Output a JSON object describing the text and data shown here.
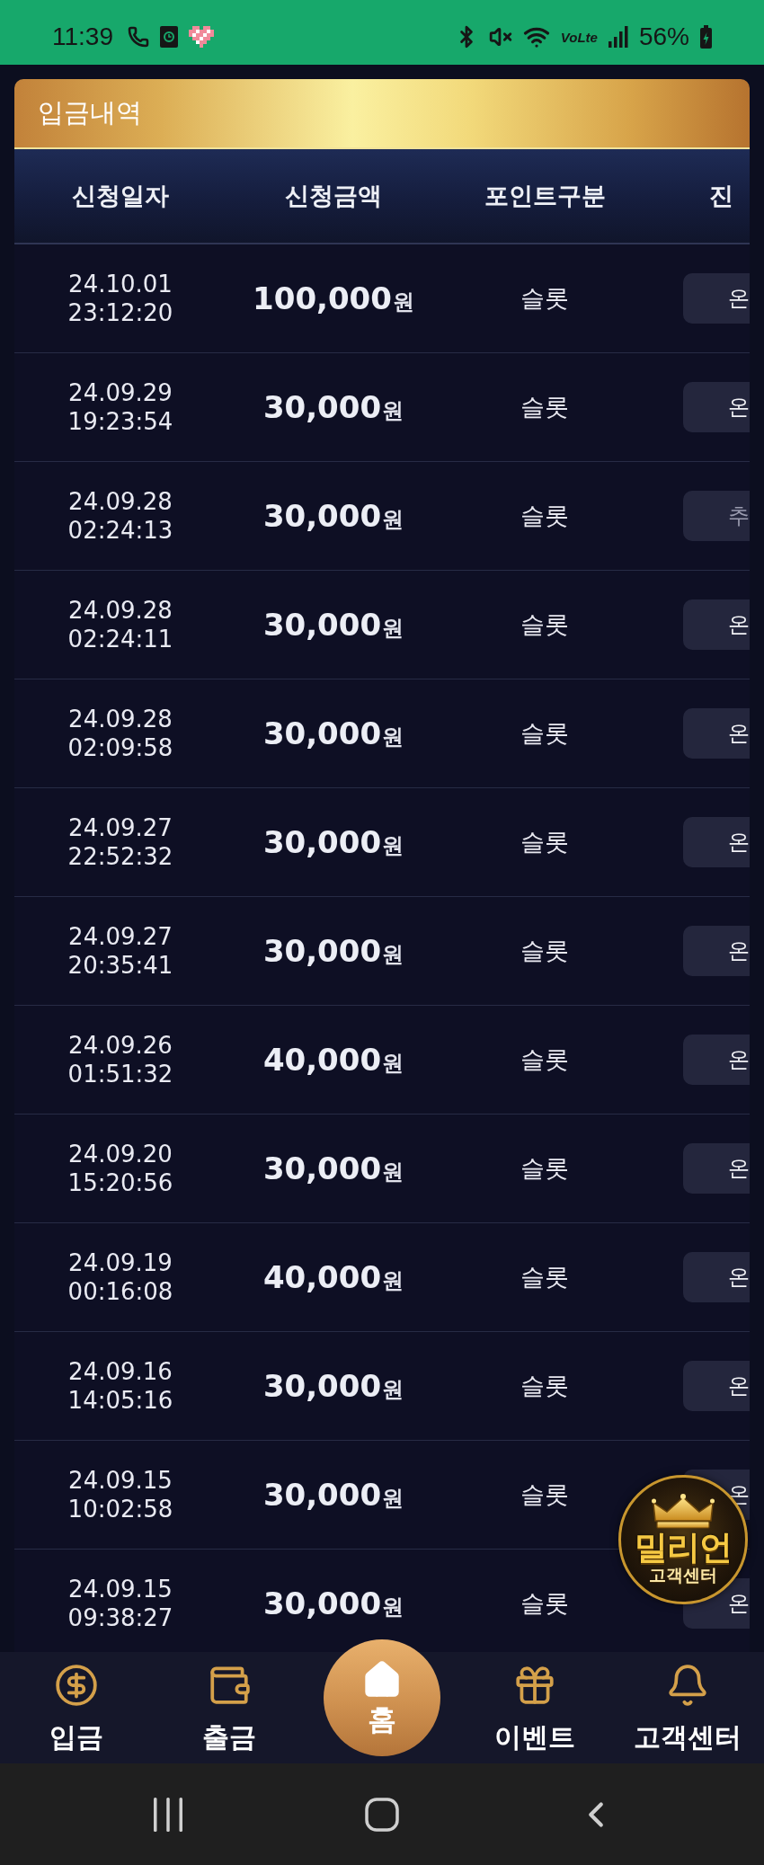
{
  "status_bar": {
    "time": "11:39",
    "network_label": "VoLte",
    "battery": "56%"
  },
  "panel": {
    "title": "입금내역"
  },
  "table": {
    "columns": [
      "신청일자",
      "신청금액",
      "포인트구분",
      "진"
    ],
    "rows": [
      {
        "date": "24.10.01",
        "time": "23:12:20",
        "amount": "100,000",
        "unit": "원",
        "point_type": "슬롯",
        "status": "온",
        "dimmed": false
      },
      {
        "date": "24.09.29",
        "time": "19:23:54",
        "amount": "30,000",
        "unit": "원",
        "point_type": "슬롯",
        "status": "온",
        "dimmed": false
      },
      {
        "date": "24.09.28",
        "time": "02:24:13",
        "amount": "30,000",
        "unit": "원",
        "point_type": "슬롯",
        "status": "추",
        "dimmed": true
      },
      {
        "date": "24.09.28",
        "time": "02:24:11",
        "amount": "30,000",
        "unit": "원",
        "point_type": "슬롯",
        "status": "온",
        "dimmed": false
      },
      {
        "date": "24.09.28",
        "time": "02:09:58",
        "amount": "30,000",
        "unit": "원",
        "point_type": "슬롯",
        "status": "온",
        "dimmed": false
      },
      {
        "date": "24.09.27",
        "time": "22:52:32",
        "amount": "30,000",
        "unit": "원",
        "point_type": "슬롯",
        "status": "온",
        "dimmed": false
      },
      {
        "date": "24.09.27",
        "time": "20:35:41",
        "amount": "30,000",
        "unit": "원",
        "point_type": "슬롯",
        "status": "온",
        "dimmed": false
      },
      {
        "date": "24.09.26",
        "time": "01:51:32",
        "amount": "40,000",
        "unit": "원",
        "point_type": "슬롯",
        "status": "온",
        "dimmed": false
      },
      {
        "date": "24.09.20",
        "time": "15:20:56",
        "amount": "30,000",
        "unit": "원",
        "point_type": "슬롯",
        "status": "온",
        "dimmed": false
      },
      {
        "date": "24.09.19",
        "time": "00:16:08",
        "amount": "40,000",
        "unit": "원",
        "point_type": "슬롯",
        "status": "온",
        "dimmed": false
      },
      {
        "date": "24.09.16",
        "time": "14:05:16",
        "amount": "30,000",
        "unit": "원",
        "point_type": "슬롯",
        "status": "온",
        "dimmed": false
      },
      {
        "date": "24.09.15",
        "time": "10:02:58",
        "amount": "30,000",
        "unit": "원",
        "point_type": "슬롯",
        "status": "온",
        "dimmed": false
      },
      {
        "date": "24.09.15",
        "time": "09:38:27",
        "amount": "30,000",
        "unit": "원",
        "point_type": "슬롯",
        "status": "온",
        "dimmed": false
      }
    ]
  },
  "floating_badge": {
    "title": "밀리언",
    "subtitle": "고객센터"
  },
  "bottom_nav": [
    {
      "label": "입금",
      "kind": "deposit"
    },
    {
      "label": "출금",
      "kind": "withdraw"
    },
    {
      "label": "홈",
      "kind": "home"
    },
    {
      "label": "이벤트",
      "kind": "event"
    },
    {
      "label": "고객센터",
      "kind": "support"
    }
  ]
}
